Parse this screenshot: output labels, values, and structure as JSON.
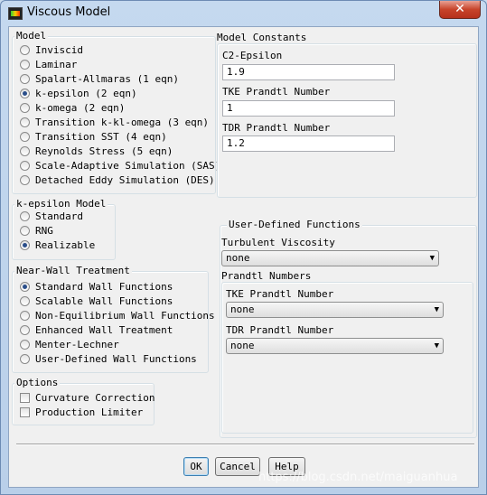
{
  "window": {
    "title": "Viscous Model",
    "close_glyph": "✕"
  },
  "model": {
    "title": "Model",
    "options": [
      {
        "label": "Inviscid",
        "selected": false
      },
      {
        "label": "Laminar",
        "selected": false
      },
      {
        "label": "Spalart-Allmaras (1 eqn)",
        "selected": false
      },
      {
        "label": "k-epsilon (2 eqn)",
        "selected": true
      },
      {
        "label": "k-omega (2 eqn)",
        "selected": false
      },
      {
        "label": "Transition k-kl-omega (3 eqn)",
        "selected": false
      },
      {
        "label": "Transition SST (4 eqn)",
        "selected": false
      },
      {
        "label": "Reynolds Stress (5 eqn)",
        "selected": false
      },
      {
        "label": "Scale-Adaptive Simulation (SAS)",
        "selected": false
      },
      {
        "label": "Detached Eddy Simulation (DES)",
        "selected": false
      }
    ]
  },
  "kepsilon_model": {
    "title": "k-epsilon Model",
    "options": [
      {
        "label": "Standard",
        "selected": false
      },
      {
        "label": "RNG",
        "selected": false
      },
      {
        "label": "Realizable",
        "selected": true
      }
    ]
  },
  "near_wall": {
    "title": "Near-Wall Treatment",
    "options": [
      {
        "label": "Standard Wall Functions",
        "selected": true
      },
      {
        "label": "Scalable Wall Functions",
        "selected": false
      },
      {
        "label": "Non-Equilibrium Wall Functions",
        "selected": false
      },
      {
        "label": "Enhanced Wall Treatment",
        "selected": false
      },
      {
        "label": "Menter-Lechner",
        "selected": false
      },
      {
        "label": "User-Defined Wall Functions",
        "selected": false
      }
    ]
  },
  "options": {
    "title": "Options",
    "checks": [
      {
        "label": "Curvature Correction",
        "checked": false
      },
      {
        "label": "Production Limiter",
        "checked": false
      }
    ]
  },
  "constants": {
    "title": "Model Constants",
    "fields": [
      {
        "label": "C2-Epsilon",
        "value": "1.9"
      },
      {
        "label": "TKE Prandtl Number",
        "value": "1"
      },
      {
        "label": "TDR Prandtl Number",
        "value": "1.2"
      }
    ]
  },
  "udf": {
    "title": "User-Defined Functions",
    "turbulent_viscosity_label": "Turbulent Viscosity",
    "turbulent_viscosity_value": "none",
    "prandtl_title": "Prandtl Numbers",
    "tke_label": "TKE Prandtl Number",
    "tke_value": "none",
    "tdr_label": "TDR Prandtl Number",
    "tdr_value": "none",
    "dropdown_glyph": "▼"
  },
  "buttons": {
    "ok": "OK",
    "cancel": "Cancel",
    "help": "Help"
  },
  "watermark": "https://blog.csdn.net/maiguanhua"
}
